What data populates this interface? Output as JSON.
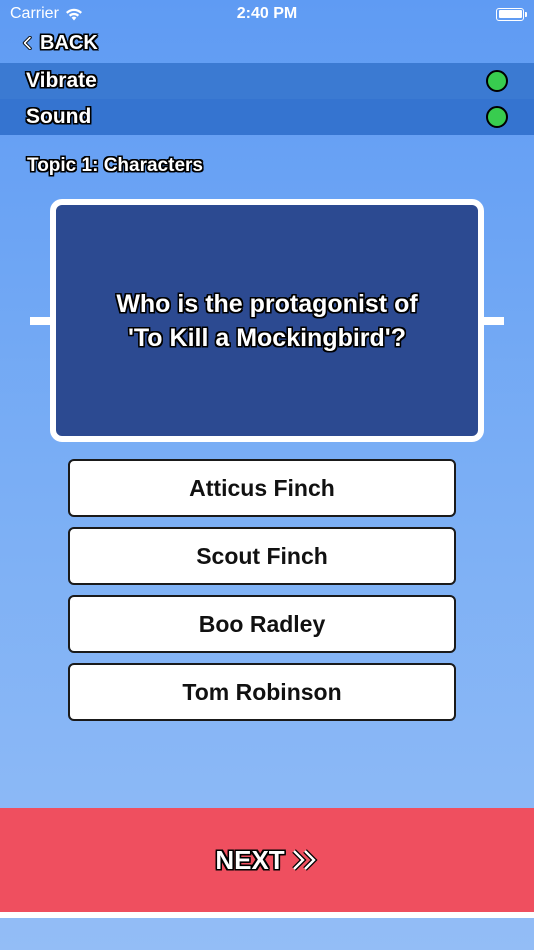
{
  "status_bar": {
    "carrier": "Carrier",
    "time": "2:40 PM"
  },
  "header": {
    "back_label": "BACK"
  },
  "settings": [
    {
      "label": "Vibrate",
      "state": "on"
    },
    {
      "label": "Sound",
      "state": "on"
    }
  ],
  "topic": "Topic 1: Characters",
  "question": {
    "line1": "Who is the protagonist of",
    "line2": "'To Kill a Mockingbird'?"
  },
  "answers": [
    "Atticus Finch",
    "Scout Finch",
    "Boo Radley",
    "Tom Robinson"
  ],
  "footer": {
    "next_label": "NEXT"
  },
  "colors": {
    "background_top": "#5f9bf3",
    "settings_band": "#3a78d1",
    "question_card": "#2c4a91",
    "toggle_on": "#38cc4f",
    "next_bar": "#ef4f5f"
  }
}
